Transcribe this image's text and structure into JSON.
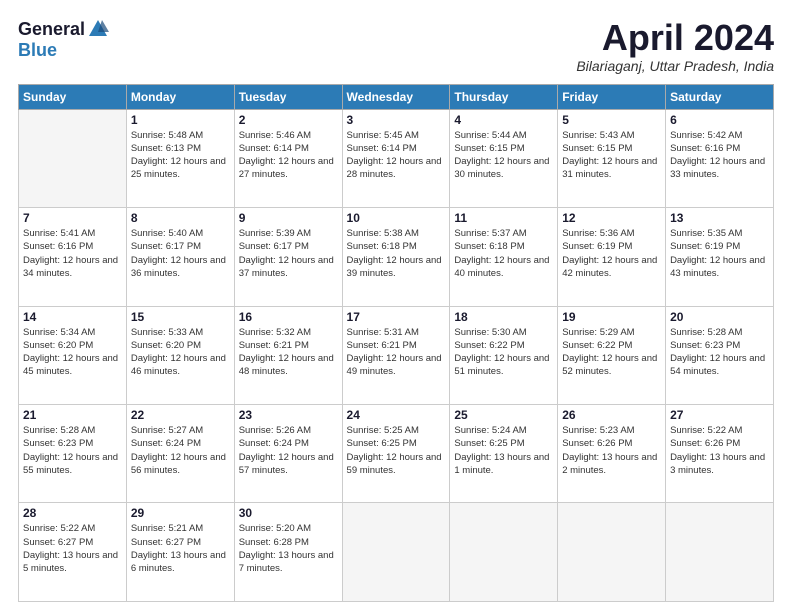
{
  "logo": {
    "general": "General",
    "blue": "Blue"
  },
  "title": "April 2024",
  "location": "Bilariaganj, Uttar Pradesh, India",
  "weekdays": [
    "Sunday",
    "Monday",
    "Tuesday",
    "Wednesday",
    "Thursday",
    "Friday",
    "Saturday"
  ],
  "weeks": [
    [
      {
        "day": "",
        "empty": true
      },
      {
        "day": "1",
        "sunrise": "Sunrise: 5:48 AM",
        "sunset": "Sunset: 6:13 PM",
        "daylight": "Daylight: 12 hours and 25 minutes."
      },
      {
        "day": "2",
        "sunrise": "Sunrise: 5:46 AM",
        "sunset": "Sunset: 6:14 PM",
        "daylight": "Daylight: 12 hours and 27 minutes."
      },
      {
        "day": "3",
        "sunrise": "Sunrise: 5:45 AM",
        "sunset": "Sunset: 6:14 PM",
        "daylight": "Daylight: 12 hours and 28 minutes."
      },
      {
        "day": "4",
        "sunrise": "Sunrise: 5:44 AM",
        "sunset": "Sunset: 6:15 PM",
        "daylight": "Daylight: 12 hours and 30 minutes."
      },
      {
        "day": "5",
        "sunrise": "Sunrise: 5:43 AM",
        "sunset": "Sunset: 6:15 PM",
        "daylight": "Daylight: 12 hours and 31 minutes."
      },
      {
        "day": "6",
        "sunrise": "Sunrise: 5:42 AM",
        "sunset": "Sunset: 6:16 PM",
        "daylight": "Daylight: 12 hours and 33 minutes."
      }
    ],
    [
      {
        "day": "7",
        "sunrise": "Sunrise: 5:41 AM",
        "sunset": "Sunset: 6:16 PM",
        "daylight": "Daylight: 12 hours and 34 minutes."
      },
      {
        "day": "8",
        "sunrise": "Sunrise: 5:40 AM",
        "sunset": "Sunset: 6:17 PM",
        "daylight": "Daylight: 12 hours and 36 minutes."
      },
      {
        "day": "9",
        "sunrise": "Sunrise: 5:39 AM",
        "sunset": "Sunset: 6:17 PM",
        "daylight": "Daylight: 12 hours and 37 minutes."
      },
      {
        "day": "10",
        "sunrise": "Sunrise: 5:38 AM",
        "sunset": "Sunset: 6:18 PM",
        "daylight": "Daylight: 12 hours and 39 minutes."
      },
      {
        "day": "11",
        "sunrise": "Sunrise: 5:37 AM",
        "sunset": "Sunset: 6:18 PM",
        "daylight": "Daylight: 12 hours and 40 minutes."
      },
      {
        "day": "12",
        "sunrise": "Sunrise: 5:36 AM",
        "sunset": "Sunset: 6:19 PM",
        "daylight": "Daylight: 12 hours and 42 minutes."
      },
      {
        "day": "13",
        "sunrise": "Sunrise: 5:35 AM",
        "sunset": "Sunset: 6:19 PM",
        "daylight": "Daylight: 12 hours and 43 minutes."
      }
    ],
    [
      {
        "day": "14",
        "sunrise": "Sunrise: 5:34 AM",
        "sunset": "Sunset: 6:20 PM",
        "daylight": "Daylight: 12 hours and 45 minutes."
      },
      {
        "day": "15",
        "sunrise": "Sunrise: 5:33 AM",
        "sunset": "Sunset: 6:20 PM",
        "daylight": "Daylight: 12 hours and 46 minutes."
      },
      {
        "day": "16",
        "sunrise": "Sunrise: 5:32 AM",
        "sunset": "Sunset: 6:21 PM",
        "daylight": "Daylight: 12 hours and 48 minutes."
      },
      {
        "day": "17",
        "sunrise": "Sunrise: 5:31 AM",
        "sunset": "Sunset: 6:21 PM",
        "daylight": "Daylight: 12 hours and 49 minutes."
      },
      {
        "day": "18",
        "sunrise": "Sunrise: 5:30 AM",
        "sunset": "Sunset: 6:22 PM",
        "daylight": "Daylight: 12 hours and 51 minutes."
      },
      {
        "day": "19",
        "sunrise": "Sunrise: 5:29 AM",
        "sunset": "Sunset: 6:22 PM",
        "daylight": "Daylight: 12 hours and 52 minutes."
      },
      {
        "day": "20",
        "sunrise": "Sunrise: 5:28 AM",
        "sunset": "Sunset: 6:23 PM",
        "daylight": "Daylight: 12 hours and 54 minutes."
      }
    ],
    [
      {
        "day": "21",
        "sunrise": "Sunrise: 5:28 AM",
        "sunset": "Sunset: 6:23 PM",
        "daylight": "Daylight: 12 hours and 55 minutes."
      },
      {
        "day": "22",
        "sunrise": "Sunrise: 5:27 AM",
        "sunset": "Sunset: 6:24 PM",
        "daylight": "Daylight: 12 hours and 56 minutes."
      },
      {
        "day": "23",
        "sunrise": "Sunrise: 5:26 AM",
        "sunset": "Sunset: 6:24 PM",
        "daylight": "Daylight: 12 hours and 57 minutes."
      },
      {
        "day": "24",
        "sunrise": "Sunrise: 5:25 AM",
        "sunset": "Sunset: 6:25 PM",
        "daylight": "Daylight: 12 hours and 59 minutes."
      },
      {
        "day": "25",
        "sunrise": "Sunrise: 5:24 AM",
        "sunset": "Sunset: 6:25 PM",
        "daylight": "Daylight: 13 hours and 1 minute."
      },
      {
        "day": "26",
        "sunrise": "Sunrise: 5:23 AM",
        "sunset": "Sunset: 6:26 PM",
        "daylight": "Daylight: 13 hours and 2 minutes."
      },
      {
        "day": "27",
        "sunrise": "Sunrise: 5:22 AM",
        "sunset": "Sunset: 6:26 PM",
        "daylight": "Daylight: 13 hours and 3 minutes."
      }
    ],
    [
      {
        "day": "28",
        "sunrise": "Sunrise: 5:22 AM",
        "sunset": "Sunset: 6:27 PM",
        "daylight": "Daylight: 13 hours and 5 minutes."
      },
      {
        "day": "29",
        "sunrise": "Sunrise: 5:21 AM",
        "sunset": "Sunset: 6:27 PM",
        "daylight": "Daylight: 13 hours and 6 minutes."
      },
      {
        "day": "30",
        "sunrise": "Sunrise: 5:20 AM",
        "sunset": "Sunset: 6:28 PM",
        "daylight": "Daylight: 13 hours and 7 minutes."
      },
      {
        "day": "",
        "empty": true
      },
      {
        "day": "",
        "empty": true
      },
      {
        "day": "",
        "empty": true
      },
      {
        "day": "",
        "empty": true
      }
    ]
  ]
}
